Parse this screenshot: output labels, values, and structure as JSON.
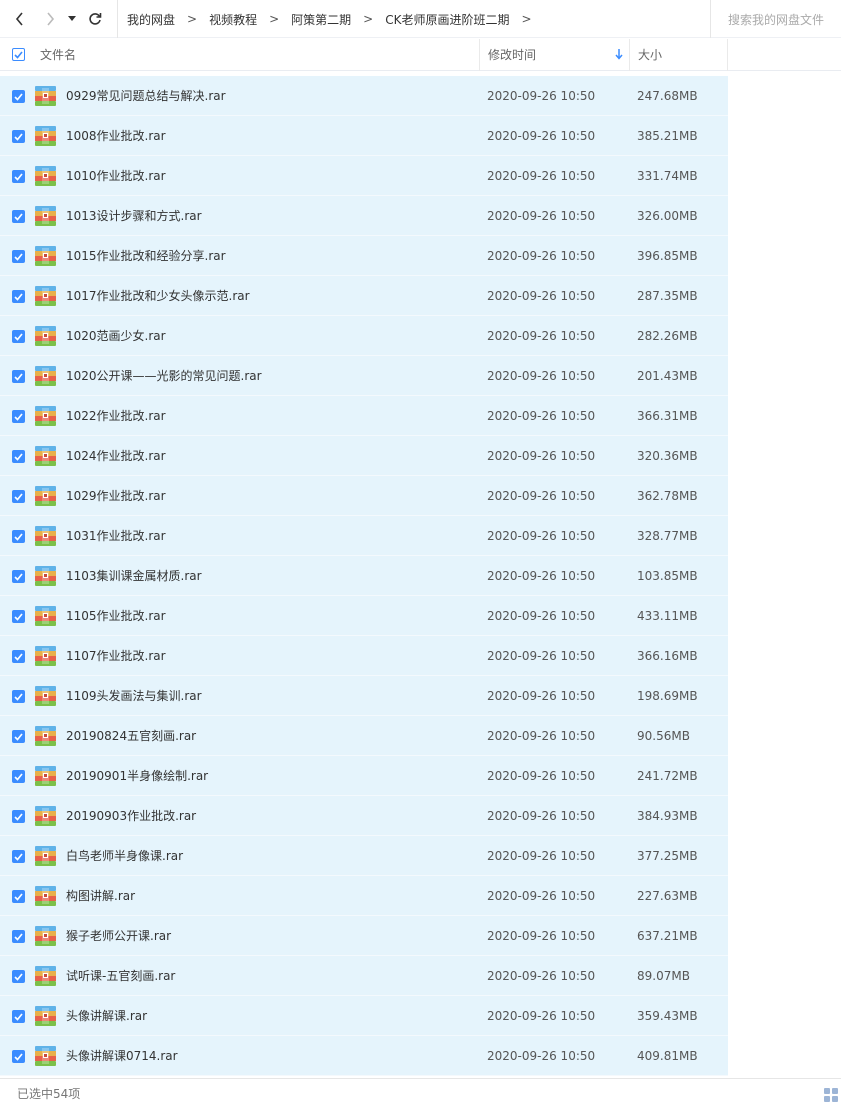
{
  "toolbar": {
    "breadcrumb": [
      "我的网盘",
      "视频教程",
      "阿策第二期",
      "CK老师原画进阶班二期"
    ],
    "search_placeholder": "搜索我的网盘文件"
  },
  "header": {
    "name": "文件名",
    "mtime": "修改时间",
    "size": "大小"
  },
  "colors": {
    "accent": "#3b8cff",
    "row_selected": "#e5f4fc"
  },
  "files": [
    {
      "name": "0929常见问题总结与解决.rar",
      "mtime": "2020-09-26 10:50",
      "size": "247.68MB"
    },
    {
      "name": "1008作业批改.rar",
      "mtime": "2020-09-26 10:50",
      "size": "385.21MB"
    },
    {
      "name": "1010作业批改.rar",
      "mtime": "2020-09-26 10:50",
      "size": "331.74MB"
    },
    {
      "name": "1013设计步骤和方式.rar",
      "mtime": "2020-09-26 10:50",
      "size": "326.00MB"
    },
    {
      "name": "1015作业批改和经验分享.rar",
      "mtime": "2020-09-26 10:50",
      "size": "396.85MB"
    },
    {
      "name": "1017作业批改和少女头像示范.rar",
      "mtime": "2020-09-26 10:50",
      "size": "287.35MB"
    },
    {
      "name": "1020范画少女.rar",
      "mtime": "2020-09-26 10:50",
      "size": "282.26MB"
    },
    {
      "name": "1020公开课——光影的常见问题.rar",
      "mtime": "2020-09-26 10:50",
      "size": "201.43MB"
    },
    {
      "name": "1022作业批改.rar",
      "mtime": "2020-09-26 10:50",
      "size": "366.31MB"
    },
    {
      "name": "1024作业批改.rar",
      "mtime": "2020-09-26 10:50",
      "size": "320.36MB"
    },
    {
      "name": "1029作业批改.rar",
      "mtime": "2020-09-26 10:50",
      "size": "362.78MB"
    },
    {
      "name": "1031作业批改.rar",
      "mtime": "2020-09-26 10:50",
      "size": "328.77MB"
    },
    {
      "name": "1103集训课金属材质.rar",
      "mtime": "2020-09-26 10:50",
      "size": "103.85MB"
    },
    {
      "name": "1105作业批改.rar",
      "mtime": "2020-09-26 10:50",
      "size": "433.11MB"
    },
    {
      "name": "1107作业批改.rar",
      "mtime": "2020-09-26 10:50",
      "size": "366.16MB"
    },
    {
      "name": "1109头发画法与集训.rar",
      "mtime": "2020-09-26 10:50",
      "size": "198.69MB"
    },
    {
      "name": "20190824五官刻画.rar",
      "mtime": "2020-09-26 10:50",
      "size": "90.56MB"
    },
    {
      "name": "20190901半身像绘制.rar",
      "mtime": "2020-09-26 10:50",
      "size": "241.72MB"
    },
    {
      "name": "20190903作业批改.rar",
      "mtime": "2020-09-26 10:50",
      "size": "384.93MB"
    },
    {
      "name": "白鸟老师半身像课.rar",
      "mtime": "2020-09-26 10:50",
      "size": "377.25MB"
    },
    {
      "name": "构图讲解.rar",
      "mtime": "2020-09-26 10:50",
      "size": "227.63MB"
    },
    {
      "name": "猴子老师公开课.rar",
      "mtime": "2020-09-26 10:50",
      "size": "637.21MB"
    },
    {
      "name": "试听课-五官刻画.rar",
      "mtime": "2020-09-26 10:50",
      "size": "89.07MB"
    },
    {
      "name": "头像讲解课.rar",
      "mtime": "2020-09-26 10:50",
      "size": "359.43MB"
    },
    {
      "name": "头像讲解课0714.rar",
      "mtime": "2020-09-26 10:50",
      "size": "409.81MB"
    }
  ],
  "status": {
    "selected_text": "已选中54项"
  }
}
